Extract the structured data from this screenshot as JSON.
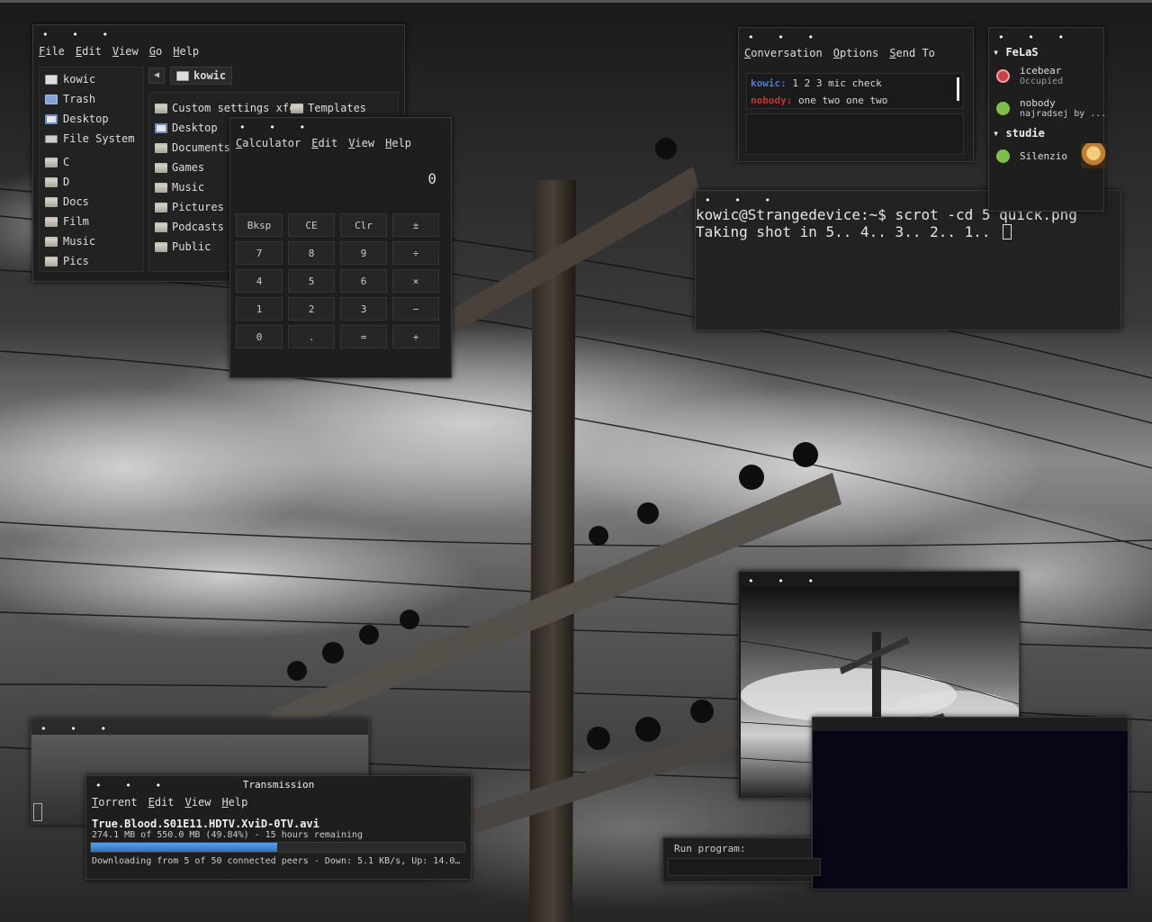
{
  "file_manager": {
    "menu": [
      "File",
      "Edit",
      "View",
      "Go",
      "Help"
    ],
    "sidebar": {
      "places": [
        "kowic",
        "Trash",
        "Desktop",
        "File System"
      ],
      "bookmarks": [
        "C",
        "D",
        "Docs",
        "Film",
        "Music",
        "Pics"
      ]
    },
    "current_folder": "kowic",
    "items": [
      "Custom settings xfce",
      "Templates",
      "Desktop",
      "Documents",
      "Games",
      "Music",
      "Pictures",
      "Podcasts",
      "Public"
    ]
  },
  "calculator": {
    "menu": [
      "Calculator",
      "Edit",
      "View",
      "Help"
    ],
    "display": "0",
    "buttons": [
      "Bksp",
      "CE",
      "Clr",
      "±",
      "7",
      "8",
      "9",
      "÷",
      "4",
      "5",
      "6",
      "×",
      "1",
      "2",
      "3",
      "−",
      "0",
      ".",
      "=",
      "+"
    ]
  },
  "chat": {
    "menu": [
      "Conversation",
      "Options",
      "Send To"
    ],
    "messages": [
      {
        "nick": "kowic:",
        "text": "1 2 3 mic check",
        "color": "#4a7bd6"
      },
      {
        "nick": "nobody:",
        "text": "one two one two",
        "color": "#d03030"
      }
    ]
  },
  "buddy_list": {
    "groups": [
      {
        "name": "FeLaS",
        "buddies": [
          {
            "name": "icebear",
            "status": "Occupied",
            "icon": "busy-icon"
          },
          {
            "name": "nobody",
            "status": "najradsej by ...",
            "icon": "available-icon"
          }
        ]
      },
      {
        "name": "studie",
        "buddies": [
          {
            "name": "Silenzio",
            "status": "",
            "icon": "available-icon"
          }
        ]
      }
    ],
    "colors": {
      "busy": "#d04040",
      "available": "#7cc04a"
    }
  },
  "terminal": {
    "line1": "kowic@Strangedevice:~$ scrot -cd 5 quick.png",
    "line2": "Taking shot in 5.. 4.. 3.. 2.. 1.. "
  },
  "transmission": {
    "title": "Transmission",
    "menu": [
      "Torrent",
      "Edit",
      "View",
      "Help"
    ],
    "torrent_name": "True.Blood.S01E11.HDTV.XviD-0TV.avi",
    "progress_text": "274.1 MB of 550.0 MB (49.84%) - 15 hours remaining",
    "progress_fraction": 0.4984,
    "status": "Downloading from 5 of 50 connected peers - Down: 5.1 KB/s, Up: 14.0…"
  },
  "run_program": {
    "label": "Run program:"
  },
  "window_dots": "• • •"
}
